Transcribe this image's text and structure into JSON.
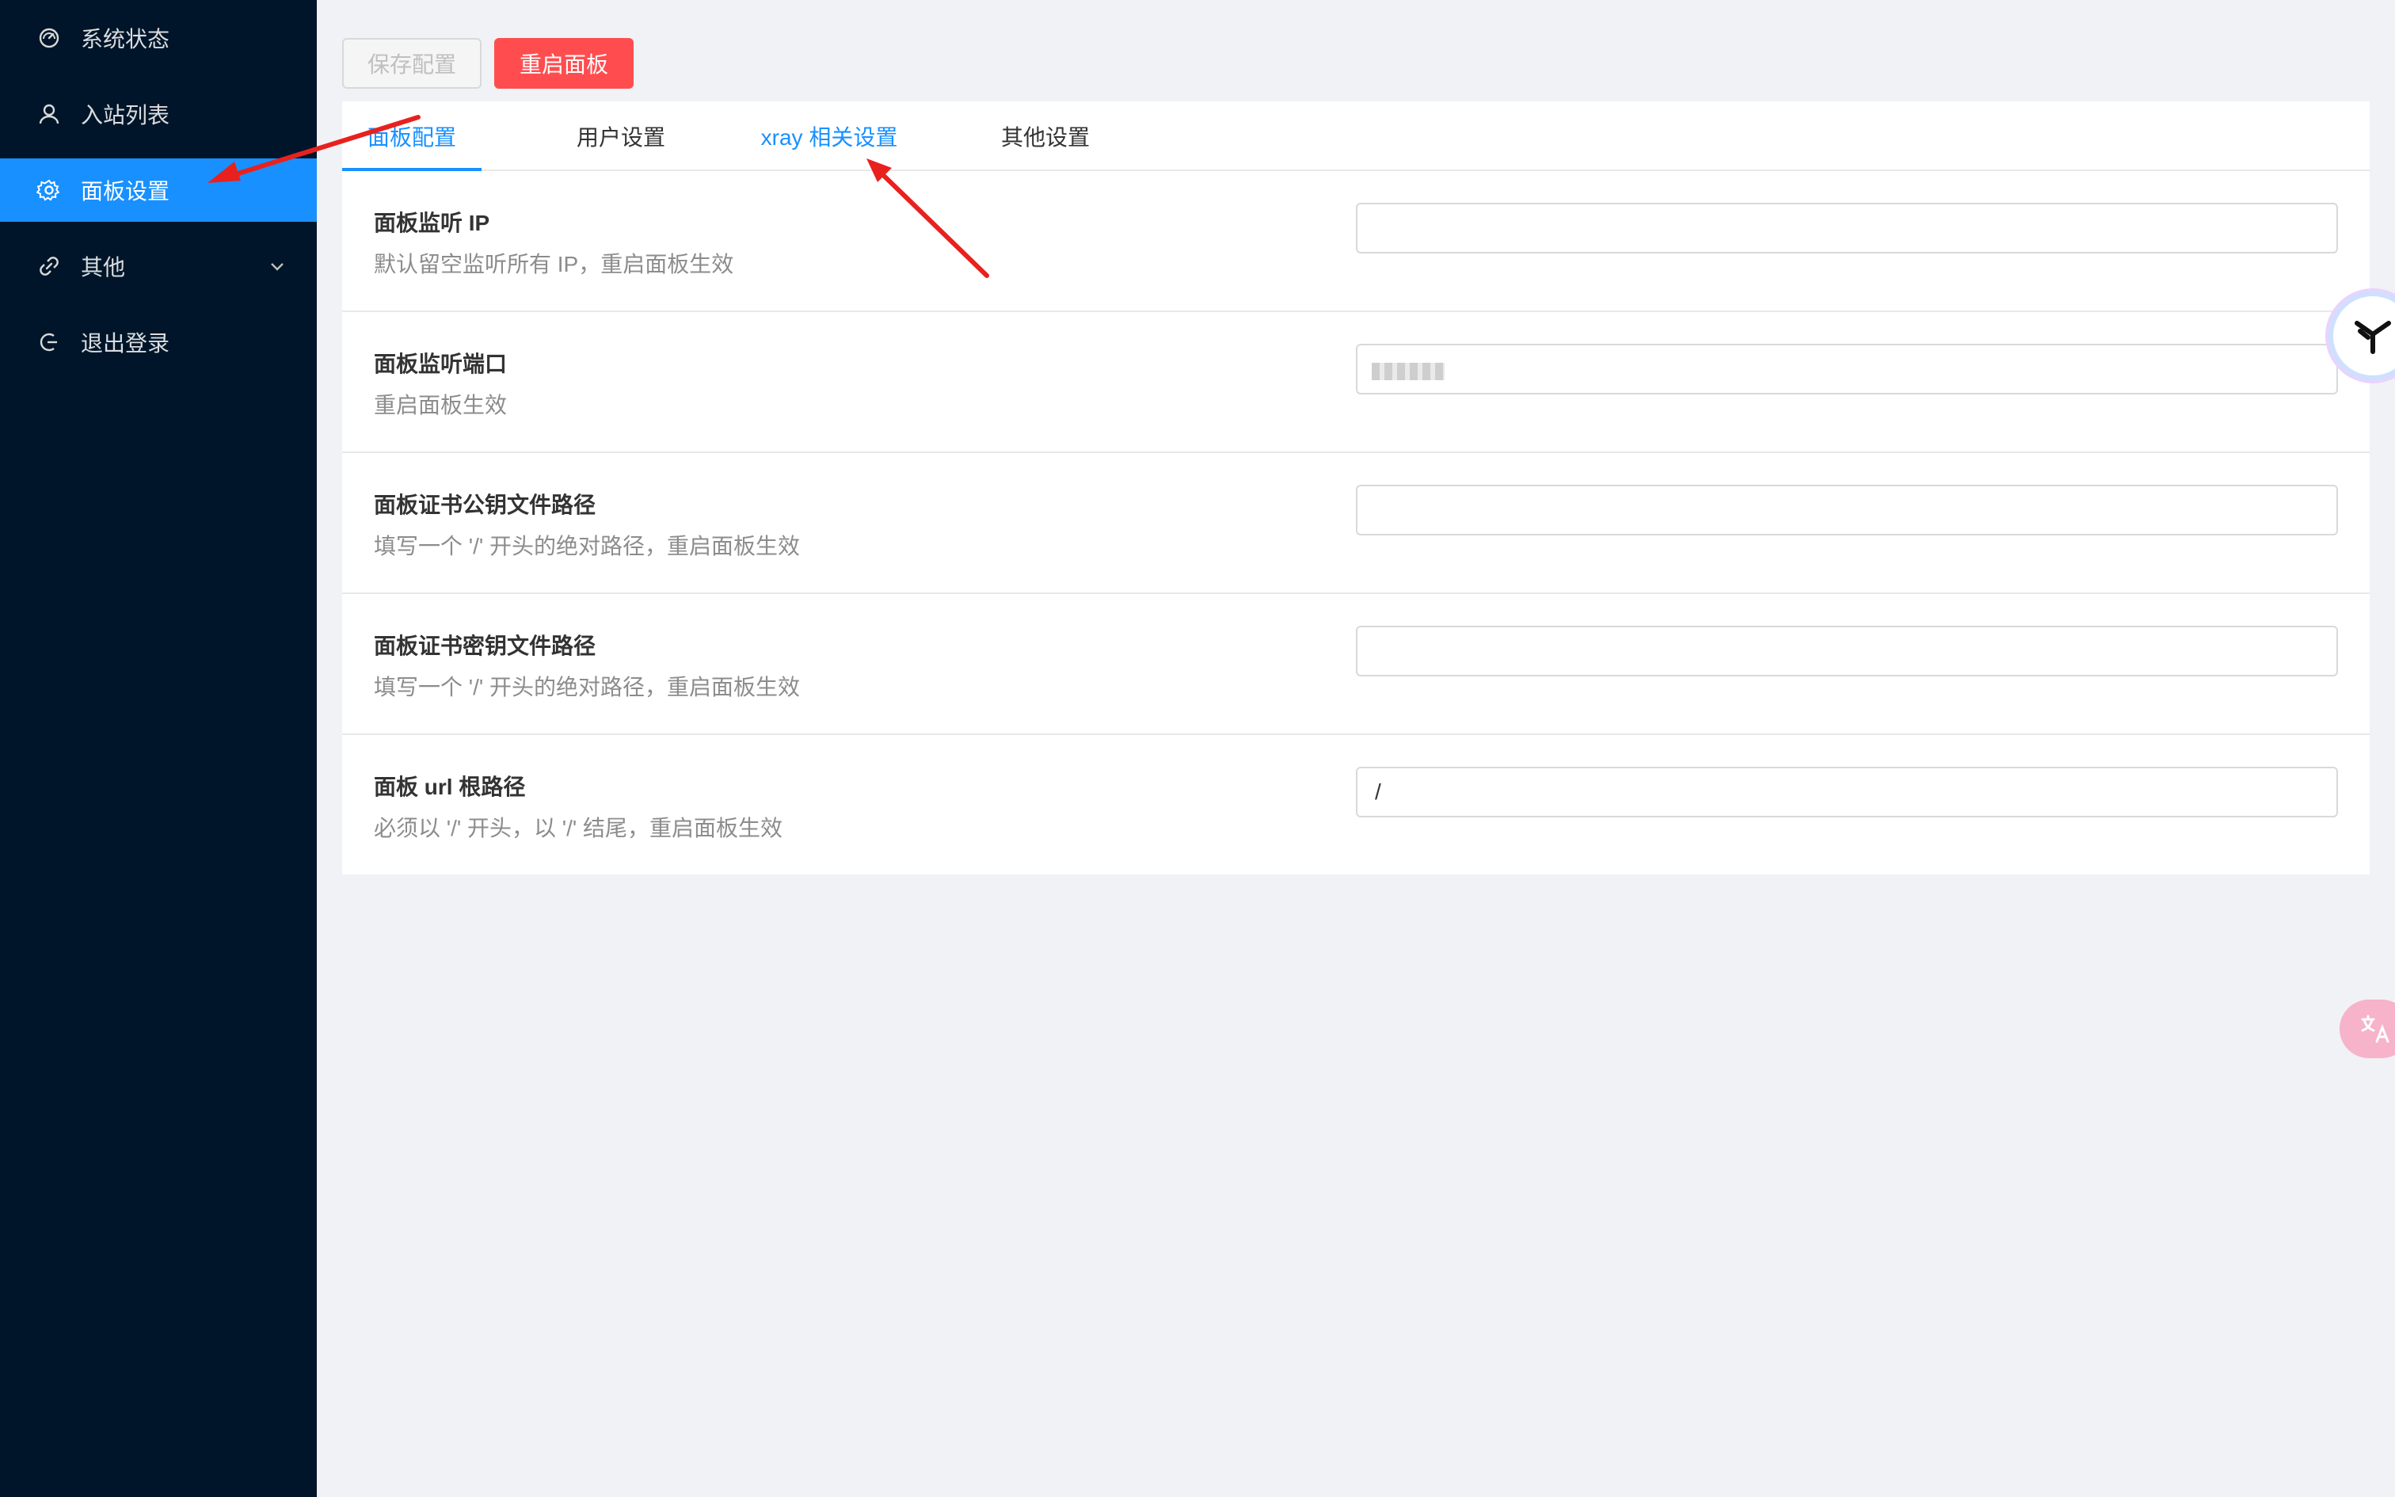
{
  "sidebar": {
    "items": [
      {
        "label": "系统状态",
        "icon": "dashboard-icon"
      },
      {
        "label": "入站列表",
        "icon": "user-icon"
      },
      {
        "label": "面板设置",
        "icon": "gear-icon",
        "active": true
      },
      {
        "label": "其他",
        "icon": "link-icon",
        "expandable": true
      },
      {
        "label": "退出登录",
        "icon": "logout-icon"
      }
    ]
  },
  "toolbar": {
    "save_label": "保存配置",
    "restart_label": "重启面板"
  },
  "tabs": [
    {
      "label": "面板配置",
      "active": true
    },
    {
      "label": "用户设置"
    },
    {
      "label": "xray 相关设置"
    },
    {
      "label": "其他设置"
    }
  ],
  "settings": [
    {
      "label": "面板监听 IP",
      "desc": "默认留空监听所有 IP，重启面板生效",
      "value": ""
    },
    {
      "label": "面板监听端口",
      "desc": "重启面板生效",
      "value": ""
    },
    {
      "label": "面板证书公钥文件路径",
      "desc": "填写一个 '/' 开头的绝对路径，重启面板生效",
      "value": ""
    },
    {
      "label": "面板证书密钥文件路径",
      "desc": "填写一个 '/' 开头的绝对路径，重启面板生效",
      "value": ""
    },
    {
      "label": "面板 url 根路径",
      "desc": "必须以 '/' 开头，以 '/' 结尾，重启面板生效",
      "value": "/"
    }
  ],
  "colors": {
    "sidebar_bg": "#001529",
    "accent": "#1890ff",
    "danger": "#ff4d4f",
    "annotation": "#e8211f"
  }
}
